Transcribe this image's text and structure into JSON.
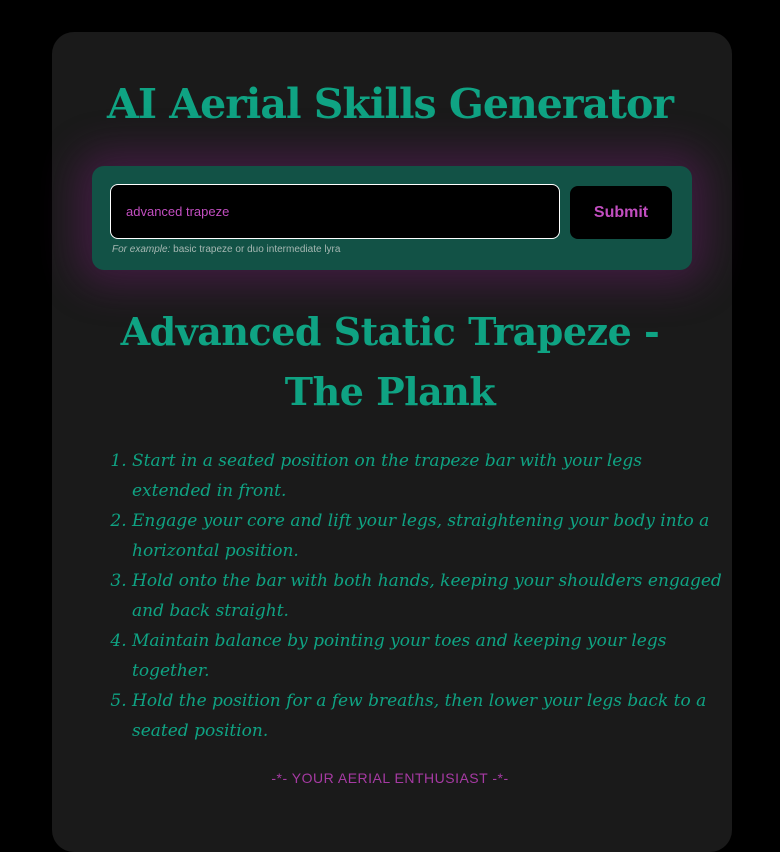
{
  "app": {
    "title": "AI Aerial Skills Generator"
  },
  "form": {
    "input_value": "advanced trapeze",
    "submit_label": "Submit",
    "example_prefix": "For example:",
    "example_text": "basic trapeze or duo intermediate lyra"
  },
  "result": {
    "title": "Advanced Static Trapeze - The Plank",
    "steps": [
      "Start in a seated position on the trapeze bar with your legs extended in front.",
      "Engage your core and lift your legs, straightening your body into a horizontal position.",
      "Hold onto the bar with both hands, keeping your shoulders engaged and back straight.",
      "Maintain balance by pointing your toes and keeping your legs together.",
      "Hold the position for a few breaths, then lower your legs back to a seated position."
    ]
  },
  "signature": "-*- YOUR AERIAL ENTHUSIAST -*-",
  "colors": {
    "page_background": "#000000",
    "card_background": "#1a1a1a",
    "accent_green": "#0fa383",
    "form_background": "#125246",
    "accent_magenta": "#c24ec0"
  }
}
